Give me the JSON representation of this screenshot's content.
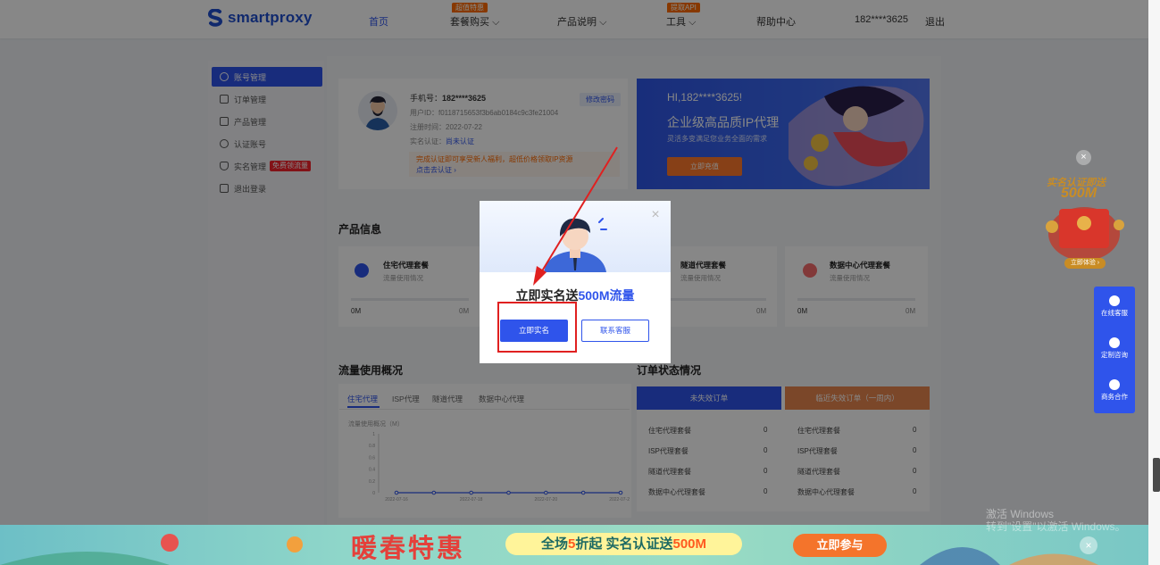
{
  "nav": {
    "logo": "smartproxy",
    "items": [
      "首页",
      "套餐购买",
      "产品说明",
      "工具",
      "帮助中心"
    ],
    "badges": {
      "package": "超值特惠",
      "tools": "提取API"
    },
    "user": "182****3625",
    "logout": "退出"
  },
  "sidebar": {
    "items": [
      "账号管理",
      "订单管理",
      "产品管理",
      "认证账号",
      "实名管理",
      "退出登录"
    ],
    "realname_tag": "免费领流量"
  },
  "profile": {
    "phone_label": "手机号：",
    "phone": "182****3625",
    "edit_password": "修改密码",
    "user_id": "用户ID：f0118715653f3b6ab0184c9c3fe21004",
    "register_time": "注册时间：2022-07-22",
    "realname_label": "实名认证：",
    "realname_status": "尚未认证",
    "notice": "完成认证即可享受新人福利，超低价格领取IP资源",
    "verify_link": "点击去认证 ›"
  },
  "banner": {
    "greeting": "HI,182****3625!",
    "headline": "企业级高品质IP代理",
    "sub": "灵活多变满足您业务全面的需求",
    "cta": "立即充值"
  },
  "products": {
    "title": "产品信息",
    "cards": [
      {
        "name": "住宅代理套餐",
        "sub": "流量使用情况",
        "used": "0M",
        "total": "0M",
        "color": "#2f54eb"
      },
      {
        "name": "隧道代理套餐",
        "sub": "流量使用情况",
        "used": "0M",
        "total": "0M",
        "color": "#2f54eb"
      },
      {
        "name": "数据中心代理套餐",
        "sub": "流量使用情况",
        "used": "0M",
        "total": "0M",
        "color": "#f5222d"
      }
    ]
  },
  "usage": {
    "title": "流量使用概况",
    "tabs": [
      "住宅代理",
      "ISP代理",
      "隧道代理",
      "数据中心代理"
    ],
    "chart_label": "流量使用概况（M）",
    "chart_data": {
      "type": "line",
      "title": "",
      "ylabel": "流量使用概况（M）",
      "x": [
        "2022-07-16",
        "2022-07-17",
        "2022-07-18",
        "2022-07-19",
        "2022-07-20",
        "2022-07-21",
        "2022-07-22"
      ],
      "x_tick_labels": [
        "2022-07-16",
        "2022-07-18",
        "2022-07-20",
        "2022-07-22"
      ],
      "y_ticks": [
        "1",
        "0.8",
        "0.6",
        "0.4",
        "0.2",
        "0"
      ],
      "series": [
        {
          "values": [
            0,
            0,
            0,
            0,
            0,
            0,
            0
          ]
        }
      ],
      "ylim": [
        0,
        1
      ],
      "color": "#2f54eb"
    }
  },
  "orders": {
    "title": "订单状态情况",
    "left_header": "未失效订单",
    "right_header": "临近失效订单（一周内）",
    "rows": [
      {
        "name": "住宅代理套餐",
        "left": "0",
        "right": "0"
      },
      {
        "name": "ISP代理套餐",
        "left": "0",
        "right": "0"
      },
      {
        "name": "隧道代理套餐",
        "left": "0",
        "right": "0"
      },
      {
        "name": "数据中心代理套餐",
        "left": "0",
        "right": "0"
      }
    ]
  },
  "modal": {
    "title_prefix": "立即实名送",
    "title_highlight": "500M流量",
    "primary": "立即实名",
    "secondary": "联系客服",
    "close": "×"
  },
  "float_bar": [
    "在线客服",
    "定制咨询",
    "商务合作"
  ],
  "promo": {
    "line1": "实名认证即送",
    "line2": "500M",
    "cta": "立即体验 ›",
    "close": "×"
  },
  "bottom_banner": {
    "big": "暖春特惠",
    "pill_a": "全场",
    "pill_num": "5",
    "pill_b": "折起  实名认证送",
    "pill_c": "500M",
    "button": "立即参与",
    "close": "×"
  },
  "watermark": {
    "line1": "激活 Windows",
    "line2": "转到\"设置\"以激活 Windows。"
  }
}
